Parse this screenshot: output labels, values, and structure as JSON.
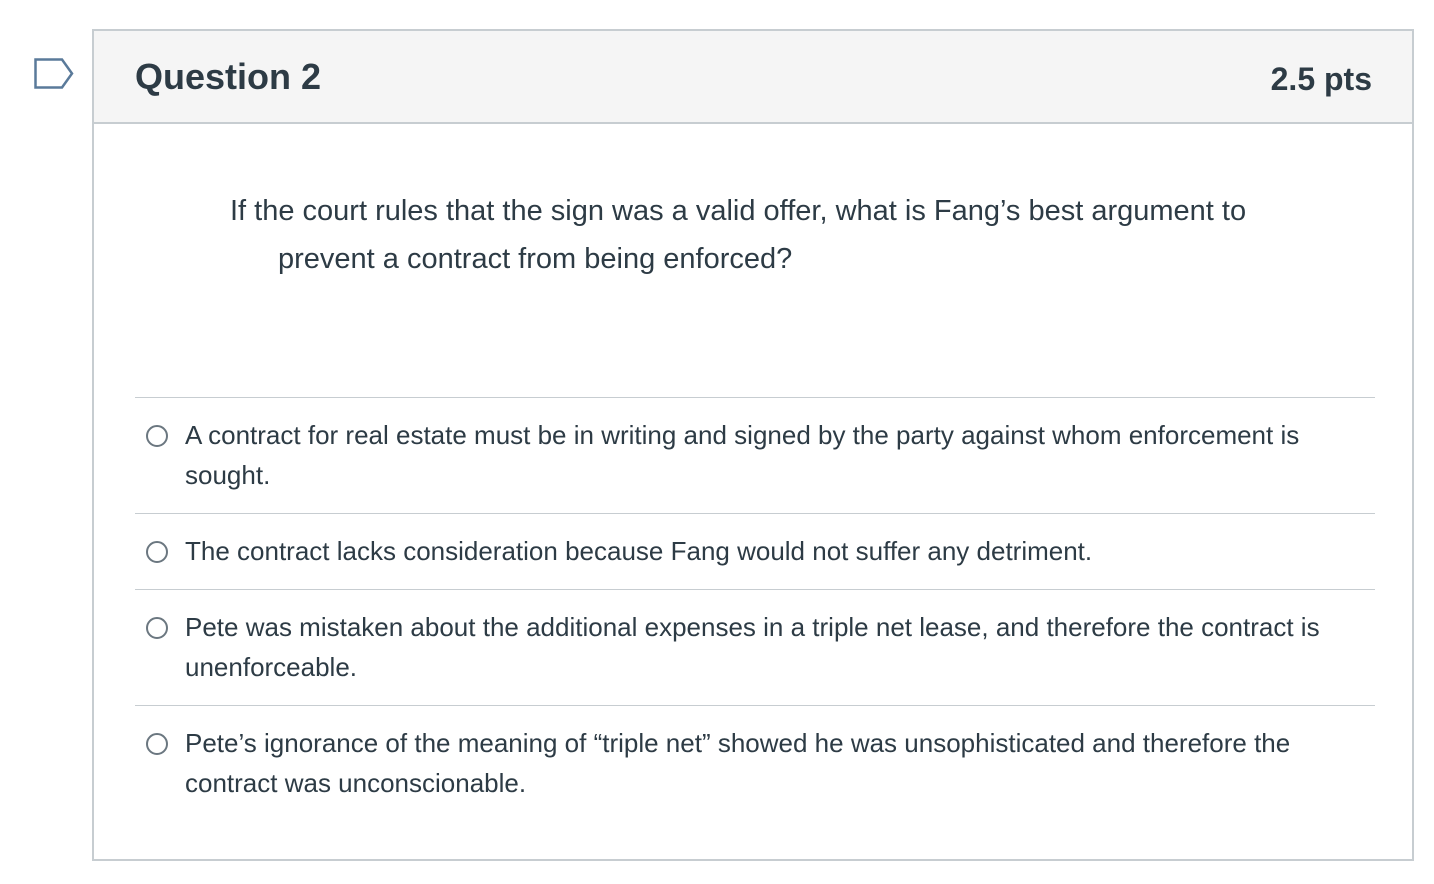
{
  "question": {
    "title": "Question 2",
    "points": "2.5 pts",
    "text_line1": "If the court rules that the sign was a valid offer, what is Fang’s best argument to",
    "text_line2": "prevent a contract from being enforced?"
  },
  "answers": [
    "A contract for real estate must be in writing and signed by the party against whom enforcement is sought.",
    "The contract lacks consideration because Fang would not suffer any detriment.",
    "Pete was mistaken about the additional expenses in a triple net lease, and therefore the contract is unenforceable.",
    "Pete’s ignorance of the meaning of “triple net” showed he was unsophisticated and therefore the contract was unconscionable."
  ],
  "icons": {
    "flag": "flag-question-icon",
    "radio": "radio-unselected-icon"
  },
  "colors": {
    "text": "#2d3b45",
    "border": "#c7cdd1",
    "header_bg": "#f5f5f5",
    "flag_stroke": "#5a7a9a"
  }
}
